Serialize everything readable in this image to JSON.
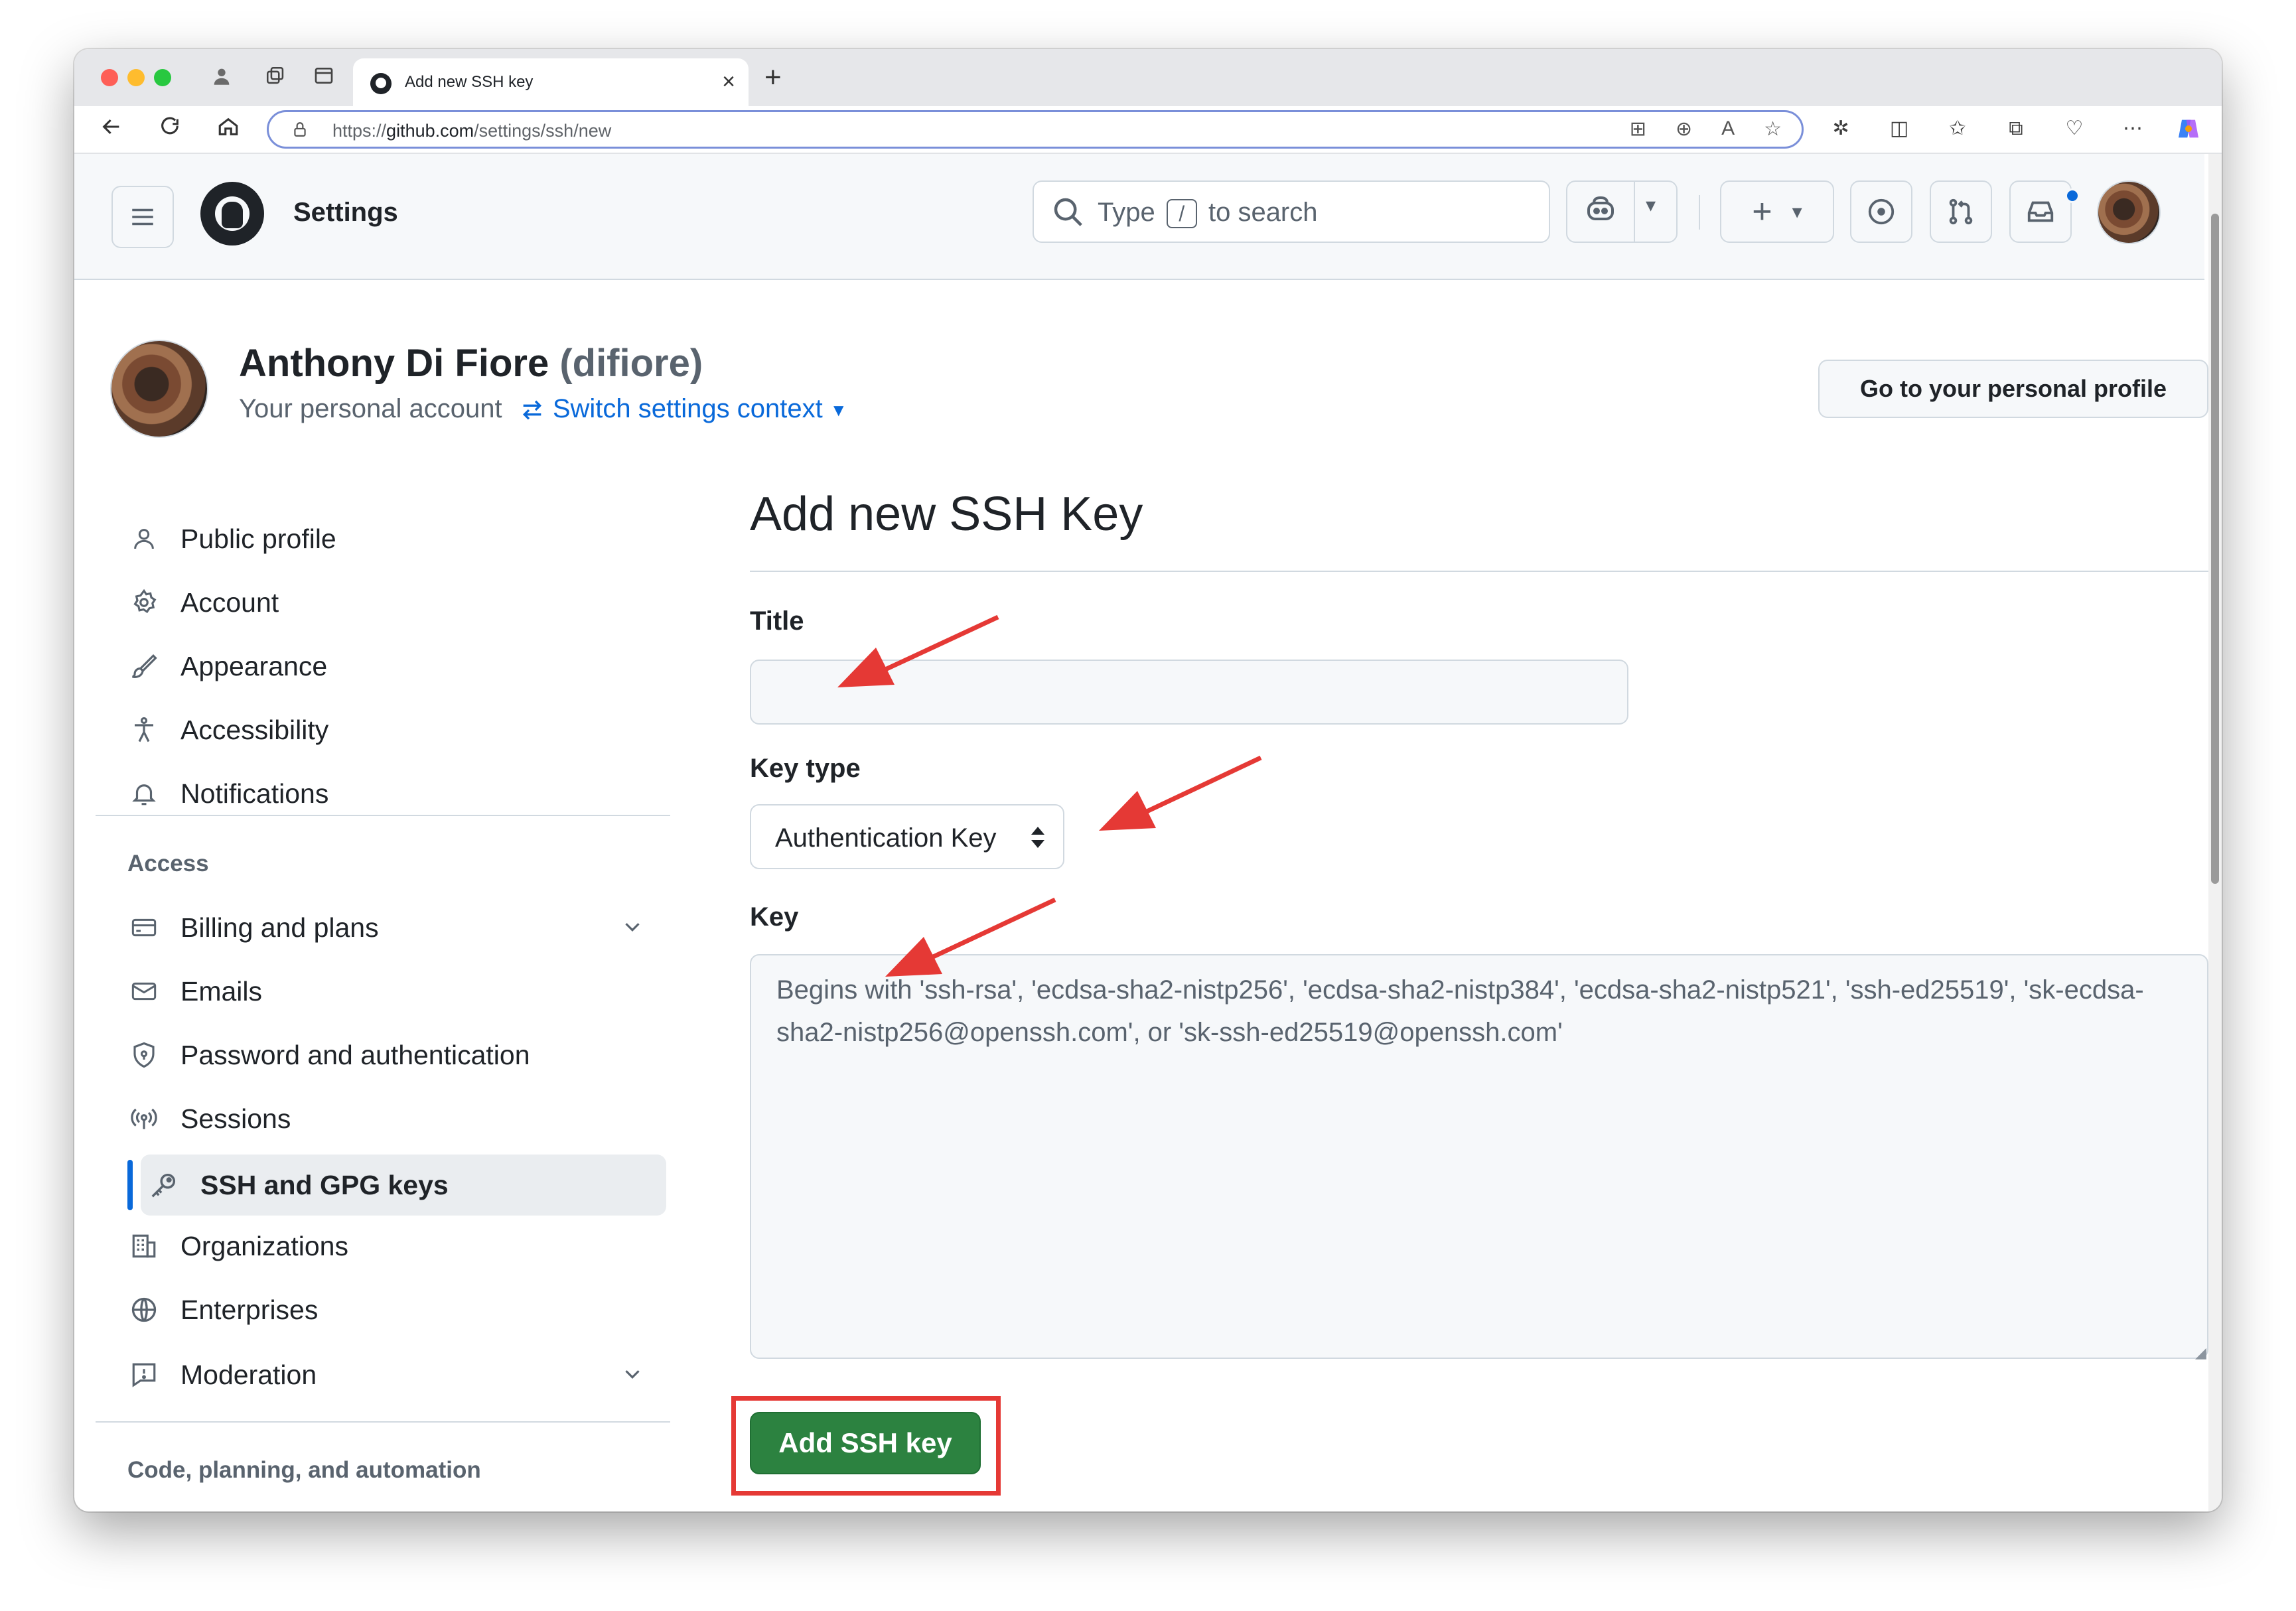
{
  "browser": {
    "tab_title": "Add new SSH key",
    "url_prefix": "https://",
    "url_domain": "github.com",
    "url_path": "/settings/ssh/new"
  },
  "header": {
    "title": "Settings",
    "search_before": "Type",
    "search_key": "/",
    "search_after": "to search"
  },
  "user": {
    "name": "Anthony Di Fiore",
    "login": "(difiore)",
    "subtitle": "Your personal account",
    "switch_label": "Switch settings context",
    "profile_button": "Go to your personal profile"
  },
  "sidebar": {
    "items": [
      {
        "label": "Public profile",
        "icon": "person-icon"
      },
      {
        "label": "Account",
        "icon": "gear-icon"
      },
      {
        "label": "Appearance",
        "icon": "paintbrush-icon"
      },
      {
        "label": "Accessibility",
        "icon": "accessibility-icon"
      },
      {
        "label": "Notifications",
        "icon": "bell-icon"
      }
    ],
    "access_heading": "Access",
    "access_items": [
      {
        "label": "Billing and plans",
        "icon": "credit-card-icon"
      },
      {
        "label": "Emails",
        "icon": "mail-icon"
      },
      {
        "label": "Password and authentication",
        "icon": "shield-lock-icon"
      },
      {
        "label": "Sessions",
        "icon": "broadcast-icon"
      },
      {
        "label": "SSH and GPG keys",
        "icon": "key-icon"
      },
      {
        "label": "Organizations",
        "icon": "organization-icon"
      },
      {
        "label": "Enterprises",
        "icon": "globe-icon"
      },
      {
        "label": "Moderation",
        "icon": "report-icon"
      }
    ],
    "code_heading": "Code, planning, and automation"
  },
  "form": {
    "page_title": "Add new SSH Key",
    "title_label": "Title",
    "title_value": "",
    "key_type_label": "Key type",
    "key_type_value": "Authentication Key",
    "key_label": "Key",
    "key_placeholder": "Begins with 'ssh-rsa', 'ecdsa-sha2-nistp256', 'ecdsa-sha2-nistp384', 'ecdsa-sha2-nistp521', 'ssh-ed25519', 'sk-ecdsa-sha2-nistp256@openssh.com', or 'sk-ssh-ed25519@openssh.com'",
    "submit_label": "Add SSH key"
  },
  "colors": {
    "accent_blue": "#0969da",
    "button_green": "#2c8240",
    "annotation_red": "#e53935"
  }
}
